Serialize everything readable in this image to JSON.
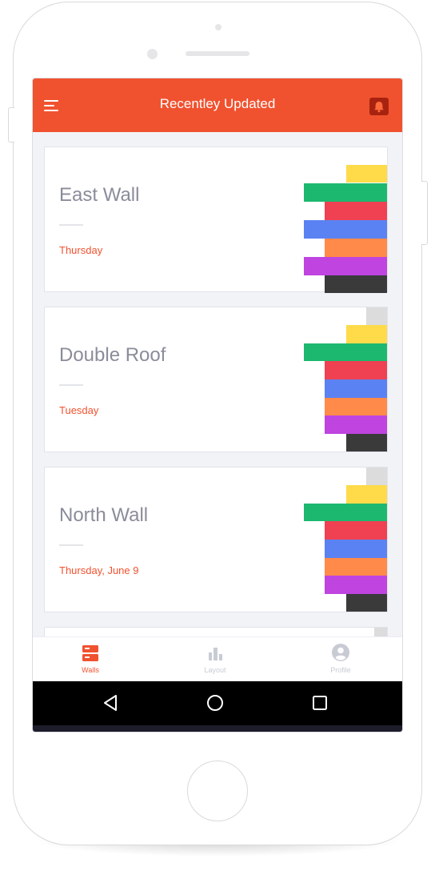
{
  "app": {
    "title": "Recentley Updated"
  },
  "colors": {
    "accent": "#f0522f",
    "yellow": "#ffdb4a",
    "green": "#1db870",
    "red": "#ef4152",
    "blue": "#5b82f2",
    "orange": "#ff8a4a",
    "purple": "#bf44e0",
    "dark": "#3a3a3a",
    "gray": "#dcdcdc"
  },
  "cards": [
    {
      "title": "East Wall",
      "date": "Thursday",
      "bars": [
        "yellow",
        "green",
        "red",
        "blue",
        "orange",
        "purple",
        "dark"
      ]
    },
    {
      "title": "Double Roof",
      "date": "Tuesday",
      "bars": [
        "gray",
        "yellow",
        "green",
        "red",
        "blue",
        "orange",
        "purple",
        "dark"
      ]
    },
    {
      "title": "North Wall",
      "date": "Thursday, June 9",
      "bars": [
        "gray",
        "yellow",
        "green",
        "red",
        "blue",
        "orange",
        "purple",
        "dark"
      ]
    }
  ],
  "nav": {
    "items": [
      {
        "label": "Walls",
        "icon": "walls-icon",
        "active": true
      },
      {
        "label": "Layout",
        "icon": "bar-chart-icon",
        "active": false
      },
      {
        "label": "Profile",
        "icon": "profile-icon",
        "active": false
      }
    ]
  },
  "system_nav": {
    "back": "back-icon",
    "home": "home-icon",
    "recents": "recents-icon"
  }
}
